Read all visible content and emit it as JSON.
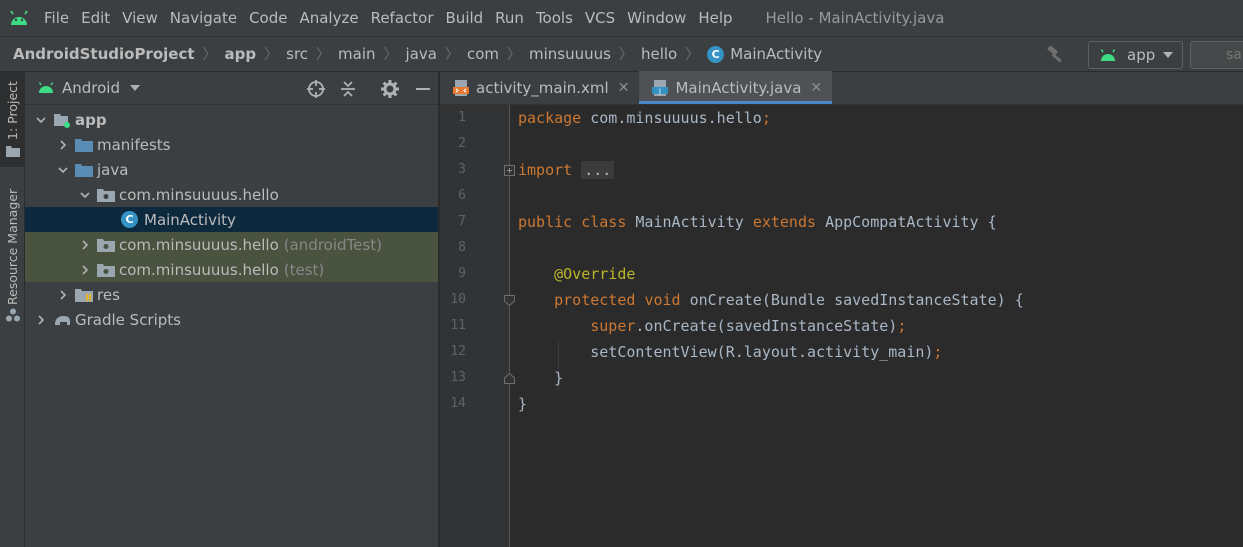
{
  "menu": {
    "items": [
      "File",
      "Edit",
      "View",
      "Navigate",
      "Code",
      "Analyze",
      "Refactor",
      "Build",
      "Run",
      "Tools",
      "VCS",
      "Window",
      "Help"
    ],
    "window_title": "Hello - MainActivity.java"
  },
  "breadcrumb": {
    "project": "AndroidStudioProject",
    "items": [
      "app",
      "src",
      "main",
      "java",
      "com",
      "minsuuuus",
      "hello",
      "MainActivity"
    ]
  },
  "toolbar": {
    "run_config": "app",
    "search_placeholder": "sa"
  },
  "toolstrip": {
    "project_tab": "1: Project",
    "resource_tab": "Resource Manager"
  },
  "project_panel": {
    "view_mode": "Android",
    "tree": [
      {
        "label": "app",
        "suffix": ""
      },
      {
        "label": "manifests",
        "suffix": ""
      },
      {
        "label": "java",
        "suffix": ""
      },
      {
        "label": "com.minsuuuus.hello",
        "suffix": ""
      },
      {
        "label": "MainActivity",
        "suffix": ""
      },
      {
        "label": "com.minsuuuus.hello",
        "suffix": "(androidTest)"
      },
      {
        "label": "com.minsuuuus.hello",
        "suffix": "(test)"
      },
      {
        "label": "res",
        "suffix": ""
      },
      {
        "label": "Gradle Scripts",
        "suffix": ""
      }
    ]
  },
  "editor": {
    "tabs": [
      {
        "label": "activity_main.xml",
        "active": false
      },
      {
        "label": "MainActivity.java",
        "active": true
      }
    ],
    "line_numbers": [
      "1",
      "2",
      "3",
      "6",
      "7",
      "8",
      "9",
      "10",
      "11",
      "12",
      "13",
      "14"
    ],
    "code": {
      "l1_kw": "package",
      "l1_rest": " com.minsuuuus.hello",
      "l1_semi": ";",
      "l3_kw": "import",
      "l3_dots": "...",
      "l7_kw1": "public",
      "l7_kw2": "class",
      "l7_name": "MainActivity",
      "l7_kw3": "extends",
      "l7_rest": "AppCompatActivity {",
      "l9_ann": "@Override",
      "l10_kw1": "protected",
      "l10_kw2": "void",
      "l10_rest": "onCreate(Bundle savedInstanceState) {",
      "l11_kw": "super",
      "l11_rest": ".onCreate(savedInstanceState)",
      "l11_semi": ";",
      "l12_rest": "setContentView(R.layout.activity_main)",
      "l12_semi": ";",
      "l13": "}",
      "l14": "}"
    }
  },
  "colors": {
    "background": "#2b2b2b",
    "panel": "#3c3f41",
    "keyword": "#cc7832",
    "annotation": "#bbb529",
    "text": "#a9b7c6",
    "selection": "#0d293e",
    "test_highlight": "#49533f",
    "android_green": "#3ddc84",
    "tab_underline": "#4a88c7"
  }
}
